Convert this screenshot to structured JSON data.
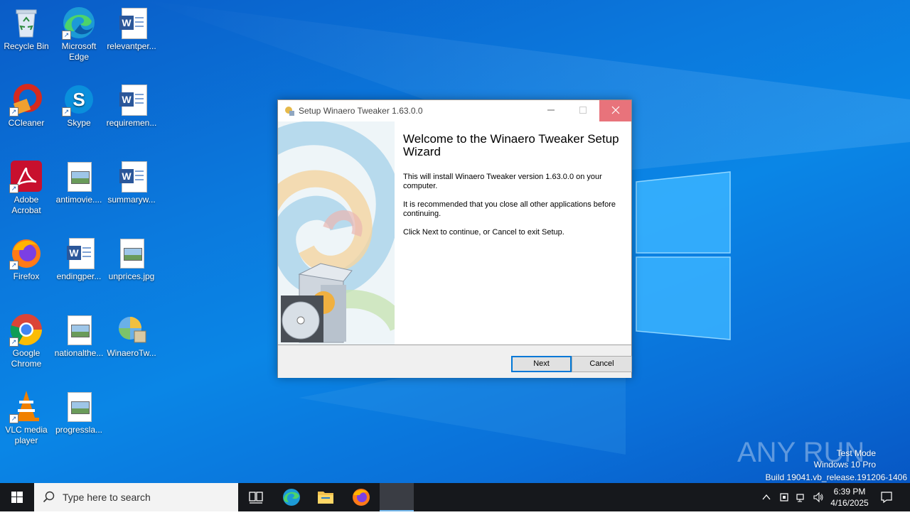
{
  "desktop": {
    "icons": [
      {
        "label": "Recycle Bin"
      },
      {
        "label": "Microsoft Edge"
      },
      {
        "label": "relevantper..."
      },
      {
        "label": "CCleaner"
      },
      {
        "label": "Skype"
      },
      {
        "label": "requiremen..."
      },
      {
        "label": "Adobe Acrobat"
      },
      {
        "label": "antimovie...."
      },
      {
        "label": "summaryw..."
      },
      {
        "label": "Firefox"
      },
      {
        "label": "endingper..."
      },
      {
        "label": "unprices.jpg"
      },
      {
        "label": "Google Chrome"
      },
      {
        "label": "nationalthe..."
      },
      {
        "label": "WinaeroTw..."
      },
      {
        "label": "VLC media player"
      },
      {
        "label": "progressla..."
      }
    ]
  },
  "dialog": {
    "title": "Setup Winaero Tweaker 1.63.0.0",
    "heading": "Welcome to the Winaero Tweaker Setup Wizard",
    "para1": "This will install Winaero Tweaker version 1.63.0.0 on your computer.",
    "para2": "It is recommended that you close all other applications before continuing.",
    "para3": "Click Next to continue, or Cancel to exit Setup.",
    "next_label": "Next",
    "cancel_label": "Cancel"
  },
  "watermark": {
    "brand": "ANY RUN",
    "line1": "Test Mode",
    "line2": "Windows 10 Pro",
    "line3": "Build 19041.vb_release.191206-1406"
  },
  "taskbar": {
    "search_placeholder": "Type here to search",
    "time": "6:39 PM",
    "date": "4/16/2025"
  },
  "colors": {
    "desktop_blue": "#0a78dc",
    "close_red": "#e8737b",
    "accent": "#0078d7",
    "taskbar": "#16181c"
  }
}
